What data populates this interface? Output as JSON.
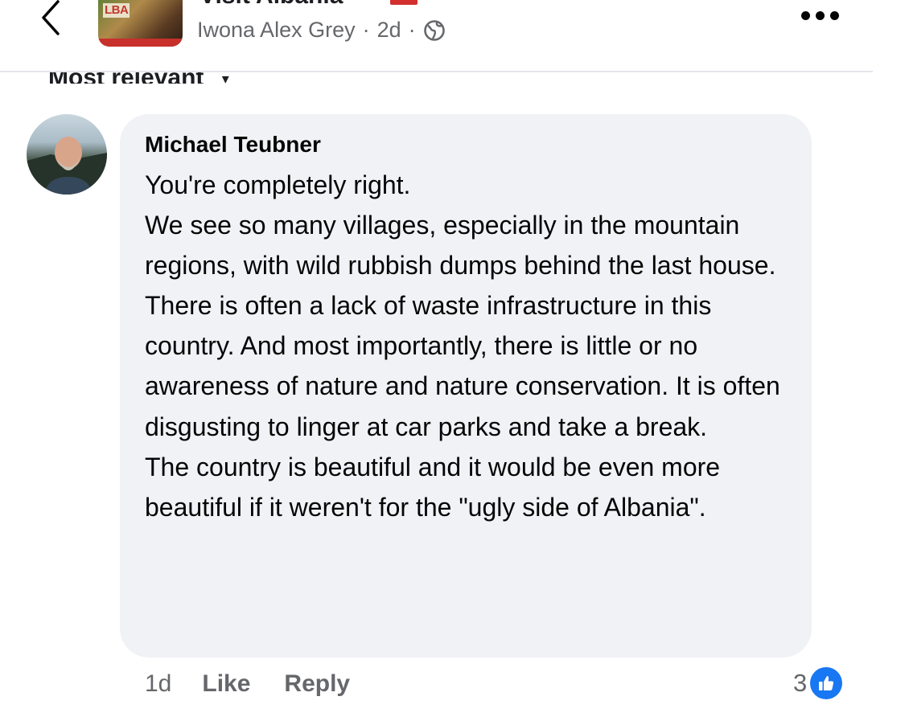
{
  "header": {
    "page_name": "Visit Albania",
    "author": "Iwona Alex Grey",
    "time": "2d",
    "separator": "·",
    "avatar_text": "LBA"
  },
  "sort": {
    "label": "Most relevant"
  },
  "comment": {
    "author": "Michael Teubner",
    "paragraphs": [
      "You're completely right.",
      "We see so many villages, especially in the mountain regions, with wild rubbish dumps behind the last house. There is often a lack of waste infrastructure in this country. And most importantly, there is little or no awareness of nature and nature conservation. It is often disgusting to linger at car parks and take a break.",
      "The country is beautiful and it would be even more beautiful if it weren't for the \"ugly side of Albania\"."
    ],
    "time": "1d",
    "like_label": "Like",
    "reply_label": "Reply",
    "reaction_count": "3"
  },
  "colors": {
    "accent": "#1877f2",
    "bubble": "#f0f2f5",
    "secondary_text": "#65676b"
  },
  "icons": [
    "chevron-left-icon",
    "globe-icon",
    "more-icon",
    "chevron-down-icon",
    "like-icon"
  ]
}
